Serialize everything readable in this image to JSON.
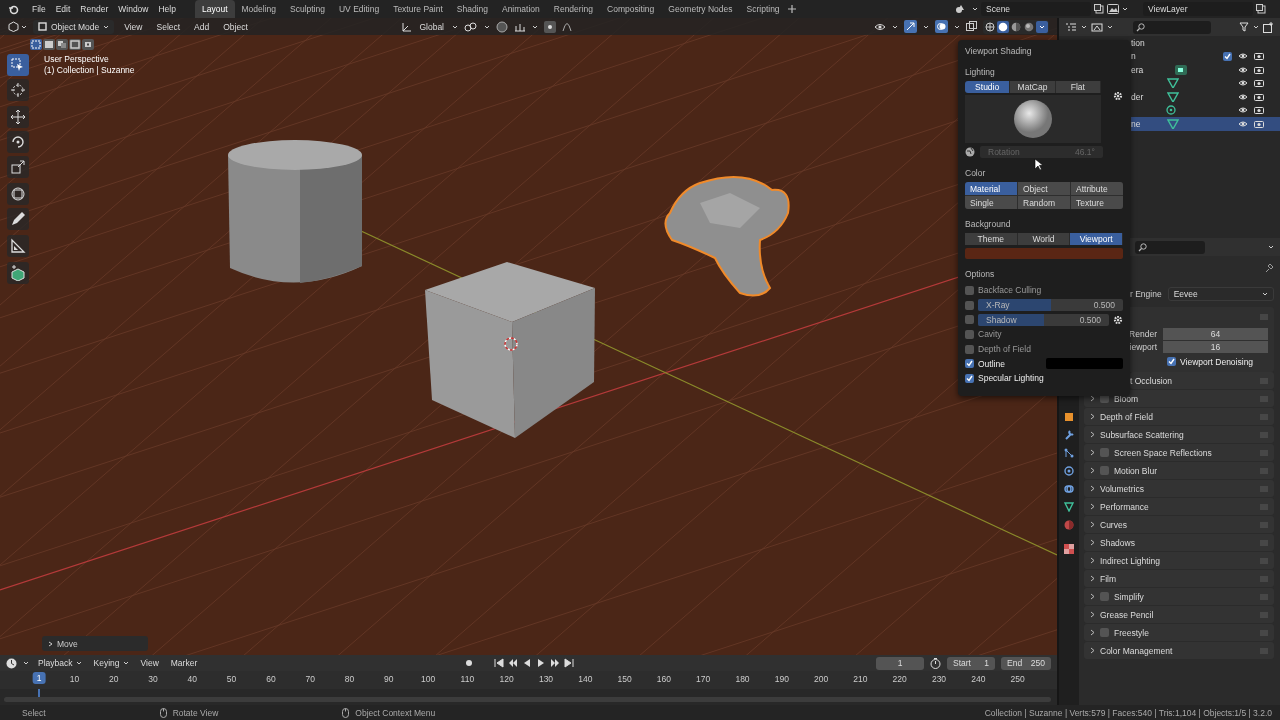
{
  "top_bar": {
    "menus": [
      "File",
      "Edit",
      "Render",
      "Window",
      "Help"
    ],
    "workspaces": [
      {
        "label": "Layout",
        "selected": true
      },
      {
        "label": "Modeling",
        "selected": false
      },
      {
        "label": "Sculpting",
        "selected": false
      },
      {
        "label": "UV Editing",
        "selected": false
      },
      {
        "label": "Texture Paint",
        "selected": false
      },
      {
        "label": "Shading",
        "selected": false
      },
      {
        "label": "Animation",
        "selected": false
      },
      {
        "label": "Rendering",
        "selected": false
      },
      {
        "label": "Compositing",
        "selected": false
      },
      {
        "label": "Geometry Nodes",
        "selected": false
      },
      {
        "label": "Scripting",
        "selected": false
      }
    ],
    "scene": "Scene",
    "view_layer": "ViewLayer"
  },
  "viewport": {
    "mode": "Object Mode",
    "menus": [
      "View",
      "Select",
      "Add",
      "Object"
    ],
    "orientation": "Global",
    "select_modes": [
      {
        "selected": true
      },
      {
        "selected": false
      },
      {
        "selected": false
      },
      {
        "selected": false
      },
      {
        "selected": false
      }
    ],
    "tools": [
      {
        "selected": true
      },
      {
        "selected": false
      },
      {
        "selected": false
      },
      {
        "selected": false
      },
      {
        "selected": false
      },
      {
        "selected": false
      },
      {
        "selected": false
      },
      {
        "selected": false
      },
      {
        "selected": false
      }
    ],
    "shading_modes": [
      {
        "selected": false
      },
      {
        "selected": true
      },
      {
        "selected": false
      },
      {
        "selected": false
      }
    ],
    "view_name": "User Perspective",
    "collection_info": "(1) Collection | Suzanne",
    "last_operator": "Move"
  },
  "shading_popover": {
    "title": "Viewport Shading",
    "lighting_label": "Lighting",
    "lighting": [
      {
        "label": "Studio",
        "selected": true
      },
      {
        "label": "MatCap",
        "selected": false
      },
      {
        "label": "Flat",
        "selected": false
      }
    ],
    "rotation_label": "Rotation",
    "rotation": "46.1°",
    "color_label": "Color",
    "color_options": [
      {
        "label": "Material",
        "selected": true
      },
      {
        "label": "Object",
        "selected": false
      },
      {
        "label": "Attribute",
        "selected": false
      },
      {
        "label": "Single",
        "selected": false
      },
      {
        "label": "Random",
        "selected": false
      },
      {
        "label": "Texture",
        "selected": false
      }
    ],
    "background_label": "Background",
    "background_options": [
      {
        "label": "Theme",
        "selected": false
      },
      {
        "label": "World",
        "selected": false
      },
      {
        "label": "Viewport",
        "selected": true
      }
    ],
    "options_label": "Options",
    "options": [
      {
        "kind": "checkbox",
        "label": "Backface Culling",
        "checked": false
      },
      {
        "kind": "slider",
        "label": "X-Ray",
        "checked": false,
        "level": 0.5,
        "value": "0.500",
        "settings": false
      },
      {
        "kind": "slider",
        "label": "Shadow",
        "checked": false,
        "level": 0.5,
        "value": "0.500",
        "settings": true
      },
      {
        "kind": "checkbox",
        "label": "Cavity",
        "checked": false
      },
      {
        "kind": "checkbox",
        "label": "Depth of Field",
        "checked": false
      },
      {
        "kind": "color",
        "label": "Outline",
        "checked": true
      },
      {
        "kind": "checkbox",
        "label": "Specular Lighting",
        "checked": true
      }
    ]
  },
  "outliner": {
    "rows": [
      {
        "kind": "root",
        "label": "tion",
        "selected": false
      },
      {
        "kind": "collection",
        "label": "n",
        "checked": true,
        "selected": false
      },
      {
        "kind": "camera",
        "label": "era",
        "selected": false
      },
      {
        "kind": "mesh",
        "selected": false
      },
      {
        "kind": "mesh",
        "label": "der",
        "selected": false
      },
      {
        "kind": "light",
        "selected": false
      },
      {
        "kind": "mesh",
        "label": "ne",
        "selected": true
      }
    ]
  },
  "properties": {
    "engine_label": "r Engine",
    "engine": "Eevee",
    "samples": [
      {
        "label": "Render",
        "value": "64"
      },
      {
        "label": "iewport",
        "value": "16"
      }
    ],
    "denoising": {
      "label": "Viewport Denoising",
      "checked": true
    },
    "panels": [
      {
        "kind": "plain",
        "label": "t Occlusion"
      },
      {
        "kind": "toggle",
        "label": "Bloom",
        "checked": false
      },
      {
        "kind": "plain",
        "label": "Depth of Field"
      },
      {
        "kind": "plain",
        "label": "Subsurface Scattering"
      },
      {
        "kind": "toggle",
        "label": "Screen Space Reflections",
        "checked": false
      },
      {
        "kind": "toggle",
        "label": "Motion Blur",
        "checked": false
      },
      {
        "kind": "plain",
        "label": "Volumetrics"
      },
      {
        "kind": "plain",
        "label": "Performance"
      },
      {
        "kind": "plain",
        "label": "Curves"
      },
      {
        "kind": "plain",
        "label": "Shadows"
      },
      {
        "kind": "plain",
        "label": "Indirect Lighting"
      },
      {
        "kind": "plain",
        "label": "Film"
      },
      {
        "kind": "toggle",
        "label": "Simplify",
        "checked": false
      },
      {
        "kind": "plain",
        "label": "Grease Pencil"
      },
      {
        "kind": "toggle",
        "label": "Freestyle",
        "checked": false
      },
      {
        "kind": "plain",
        "label": "Color Management"
      }
    ]
  },
  "timeline": {
    "menus": [
      "Playback",
      "Keying",
      "View",
      "Marker"
    ],
    "current_frame": "1",
    "start_label": "Start",
    "start": "1",
    "end_label": "End",
    "end": "250",
    "ruler": [
      {
        "label": "1",
        "current": true
      },
      {
        "label": "10",
        "current": false
      },
      {
        "label": "20",
        "current": false
      },
      {
        "label": "30",
        "current": false
      },
      {
        "label": "40",
        "current": false
      },
      {
        "label": "50",
        "current": false
      },
      {
        "label": "60",
        "current": false
      },
      {
        "label": "70",
        "current": false
      },
      {
        "label": "80",
        "current": false
      },
      {
        "label": "90",
        "current": false
      },
      {
        "label": "100",
        "current": false
      },
      {
        "label": "110",
        "current": false
      },
      {
        "label": "120",
        "current": false
      },
      {
        "label": "130",
        "current": false
      },
      {
        "label": "140",
        "current": false
      },
      {
        "label": "150",
        "current": false
      },
      {
        "label": "160",
        "current": false
      },
      {
        "label": "170",
        "current": false
      },
      {
        "label": "180",
        "current": false
      },
      {
        "label": "190",
        "current": false
      },
      {
        "label": "200",
        "current": false
      },
      {
        "label": "210",
        "current": false
      },
      {
        "label": "220",
        "current": false
      },
      {
        "label": "230",
        "current": false
      },
      {
        "label": "240",
        "current": false
      },
      {
        "label": "250",
        "current": false
      }
    ]
  },
  "status_bar": {
    "hints": [
      "Select",
      "Rotate View",
      "Object Context Menu"
    ],
    "stats": "Collection | Suzanne | Verts:579 | Faces:540 | Tris:1,104 | Objects:1/5 | 3.2.0"
  }
}
